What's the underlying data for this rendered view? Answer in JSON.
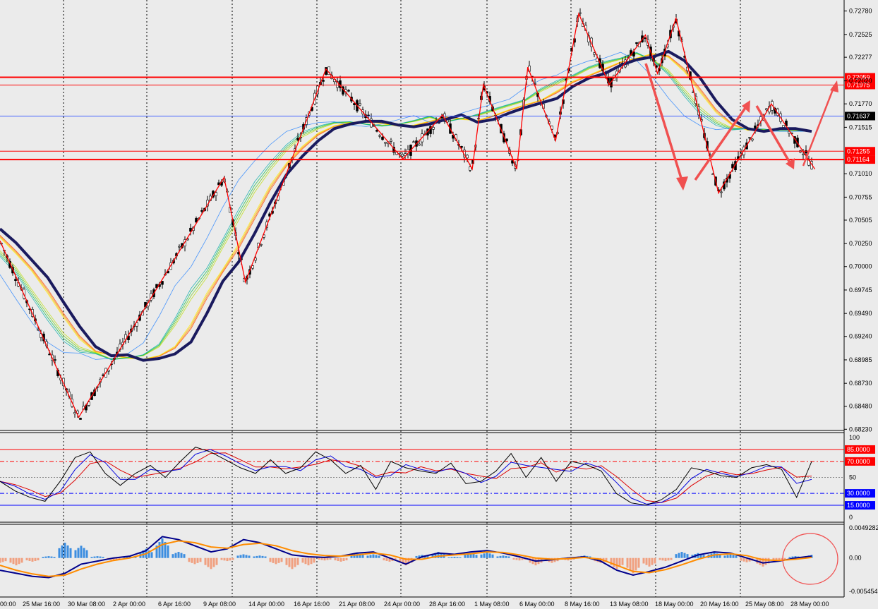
{
  "colors": {
    "background": "#ebebeb",
    "axis_text": "#000000",
    "grid": "#000000",
    "slow_ma": "#1a1a5e",
    "level_line": "#ff0000",
    "marker": "#f05050",
    "bid_line": "#4060ff",
    "stoch_main": "#000000",
    "stoch_blue": "#0000dd",
    "stoch_red": "#dd0000",
    "hist_up": "#3c8ee0",
    "hist_down": "#f0a080",
    "macd_line": "#00008b",
    "signal_line": "#ff8c00",
    "candle_bull": "#ffffff",
    "candle_bear": "#000000",
    "ribbon": [
      "#ff0000",
      "#ff4400",
      "#ff8800",
      "#ffbb00",
      "#ffee00",
      "#bbdd00",
      "#66cc00",
      "#00bb44",
      "#00aaaa",
      "#2080ff"
    ]
  },
  "chart_data": [
    {
      "type": "candlestick",
      "pane": "price",
      "ylim": [
        0.6824,
        0.728
      ],
      "y_ticks": [
        "0.72780",
        "0.72525",
        "0.72277",
        "0.72020",
        "0.71770",
        "0.71515",
        "0.71010",
        "0.70755",
        "0.70505",
        "0.70250",
        "0.70000",
        "0.69745",
        "0.69490",
        "0.69240",
        "0.68985",
        "0.68730",
        "0.68480",
        "0.68230"
      ],
      "y_tick_values": [
        0.7278,
        0.72525,
        0.72277,
        0.7202,
        0.7177,
        0.71515,
        0.7101,
        0.70755,
        0.70505,
        0.7025,
        0.7,
        0.69745,
        0.6949,
        0.6924,
        0.68985,
        0.6873,
        0.6848,
        0.6823
      ],
      "x_ticks": [
        "25 Mar 16:00",
        "30 Mar 08:00",
        "2 Apr 00:00",
        "6 Apr 16:00",
        "9 Apr 08:00",
        "14 Apr 00:00",
        "16 Apr 16:00",
        "21 Apr 08:00",
        "24 Apr 00:00",
        "28 Apr 16:00",
        "1 May 08:00",
        "6 May 00:00",
        "8 May 16:00",
        "13 May 08:00",
        "18 May 00:00",
        "20 May 16:00",
        "25 May 08:00",
        "28 May 00:00"
      ],
      "partial_first_tick": "00:00",
      "zigzag": [
        [
          0.7028,
          0.6881
        ],
        [
          0.6836,
          0.7204
        ],
        [
          0.69,
          0.7042
        ],
        [
          0.7097,
          0.7083
        ],
        [
          0.6983,
          0.7114
        ],
        [
          0.7215,
          0.706
        ],
        [
          0.7165,
          0.6973
        ],
        [
          0.7117,
          0.706
        ],
        [
          0.7198,
          0.7094
        ],
        [
          0.7106,
          0.7075
        ],
        [
          0.7217,
          0.7103
        ],
        [
          0.7137,
          0.7075
        ],
        [
          0.7275,
          0.7107
        ],
        [
          0.7198,
          0.7059
        ],
        [
          0.7252,
          0.7089
        ],
        [
          0.721,
          0.7148
        ],
        [
          0.727,
          0.7182
        ],
        [
          0.7239,
          0.7
        ],
        [
          0.708,
          0.7148
        ],
        [
          0.7177,
          0.7145
        ],
        [
          0.7106,
          0.7145
        ]
      ],
      "zigzag_prices": [
        0.7028,
        0.6836,
        0.7097,
        0.6983,
        0.7215,
        0.7117,
        0.7165,
        0.7106,
        0.7198,
        0.7106,
        0.7217,
        0.7137,
        0.7275,
        0.7198,
        0.7252,
        0.721,
        0.727,
        0.708,
        0.7177,
        0.7106
      ],
      "zigzag_times_frac": [
        0,
        0.085,
        0.242,
        0.265,
        0.352,
        0.435,
        0.478,
        0.51,
        0.522,
        0.558,
        0.57,
        0.6,
        0.625,
        0.658,
        0.697,
        0.71,
        0.73,
        0.776,
        0.833,
        0.88
      ],
      "slow_ma_samples": [
        0.7041,
        0.7026,
        0.7007,
        0.6988,
        0.6961,
        0.6935,
        0.6913,
        0.6903,
        0.6904,
        0.6898,
        0.69,
        0.6905,
        0.6918,
        0.6949,
        0.6984,
        0.7005,
        0.7036,
        0.707,
        0.71,
        0.712,
        0.7137,
        0.715,
        0.7155,
        0.7158,
        0.7158,
        0.7154,
        0.7152,
        0.7155,
        0.716,
        0.7165,
        0.7157,
        0.716,
        0.7167,
        0.7173,
        0.7178,
        0.7183,
        0.7196,
        0.7205,
        0.721,
        0.7219,
        0.7225,
        0.7228,
        0.7234,
        0.7224,
        0.7205,
        0.718,
        0.716,
        0.715,
        0.7147,
        0.715,
        0.715,
        0.7147
      ],
      "levels": [
        {
          "label": "0.72059",
          "value": 0.72059
        },
        {
          "label": "0.71975",
          "value": 0.71975
        },
        {
          "label": "0.71255",
          "value": 0.71255
        },
        {
          "label": "0.71164",
          "value": 0.71164
        }
      ],
      "bid": {
        "label": "0.71637",
        "value": 0.71637
      }
    },
    {
      "type": "line",
      "pane": "stochastic",
      "ylim": [
        0,
        100
      ],
      "y_ticks": [
        "100",
        "50",
        "0"
      ],
      "y_tick_values": [
        100,
        50,
        0
      ],
      "levels": [
        {
          "label": "85.0000",
          "value": 85,
          "style": "solid",
          "color": "#ff0000"
        },
        {
          "label": "70.0000",
          "value": 70,
          "style": "dashdot",
          "color": "#ff0000"
        },
        {
          "label": "30.0000",
          "value": 30,
          "style": "dashdot",
          "color": "#0000ff"
        },
        {
          "label": "15.0000",
          "value": 15,
          "style": "solid",
          "color": "#0000ff"
        }
      ],
      "series_samples": [
        45,
        33,
        25,
        20,
        45,
        75,
        82,
        55,
        40,
        55,
        65,
        50,
        70,
        88,
        82,
        72,
        62,
        55,
        72,
        55,
        62,
        82,
        72,
        55,
        65,
        35,
        70,
        62,
        58,
        55,
        68,
        42,
        45,
        58,
        80,
        50,
        75,
        45,
        70,
        66,
        58,
        30,
        18,
        15,
        22,
        35,
        62,
        58,
        52,
        50,
        62,
        66,
        60,
        25,
        70
      ]
    },
    {
      "type": "bar+line",
      "pane": "macd",
      "ylim": [
        -0.005454,
        0.0049282
      ],
      "y_ticks": [
        "0.0049282",
        "0.00",
        "-0.005454"
      ],
      "y_tick_values": [
        0.0049282,
        0,
        -0.005454
      ],
      "histogram_samples": [
        -0.0008,
        -0.0012,
        -0.0006,
        0.0003,
        0.0025,
        0.002,
        0.0003,
        -0.0004,
        0.0002,
        0.0015,
        0.0032,
        0.001,
        -0.001,
        -0.0018,
        -0.0005,
        0.0006,
        0.0004,
        -0.001,
        -0.0018,
        -0.0012,
        -0.0004,
        -0.0006,
        0.0008,
        0.0006,
        -0.0006,
        -0.0012,
        0.0005,
        0.001,
        0.0002,
        0.0008,
        0.0009,
        0.0004,
        -0.0004,
        -0.0012,
        -0.0008,
        -0.0004,
        0.0004,
        -0.0008,
        -0.0018,
        -0.0025,
        -0.0014,
        -0.0005,
        0.001,
        0.0008,
        0.0009,
        0.0006,
        -0.0007,
        -0.0014,
        -0.0006,
        0.0003,
        0.0005
      ],
      "macd_samples": [
        -0.002,
        -0.0025,
        -0.003,
        -0.0032,
        -0.0025,
        -0.001,
        -0.0005,
        0.0,
        0.0003,
        0.0012,
        0.0035,
        0.003,
        0.002,
        0.001,
        0.0015,
        0.003,
        0.0025,
        0.0015,
        0.0005,
        0.0002,
        0.0001,
        0.0003,
        0.0008,
        0.001,
        0.0,
        -0.001,
        0.0002,
        0.0008,
        0.0006,
        0.001,
        0.0012,
        0.0008,
        0.0002,
        -0.0005,
        -0.0003,
        0.0,
        0.0002,
        -0.0005,
        -0.002,
        -0.0028,
        -0.0022,
        -0.0015,
        -0.0005,
        0.0005,
        0.001,
        0.0008,
        0.0,
        -0.0008,
        -0.0005,
        0.0,
        0.0003
      ],
      "signal_samples": [
        -0.0012,
        -0.002,
        -0.0026,
        -0.003,
        -0.0028,
        -0.0018,
        -0.001,
        -0.0004,
        0.0,
        0.0007,
        0.0022,
        0.0028,
        0.0025,
        0.0018,
        0.0016,
        0.0022,
        0.0024,
        0.002,
        0.0012,
        0.0007,
        0.0004,
        0.0003,
        0.0005,
        0.0008,
        0.0005,
        -0.0002,
        -0.0002,
        0.0003,
        0.0005,
        0.0007,
        0.001,
        0.0009,
        0.0005,
        0.0,
        -0.0002,
        -0.0001,
        0.0001,
        -0.0002,
        -0.0012,
        -0.0022,
        -0.0024,
        -0.0019,
        -0.0011,
        -0.0002,
        0.0005,
        0.0007,
        0.0004,
        -0.0003,
        -0.0004,
        -0.0002,
        0.0001
      ]
    }
  ]
}
